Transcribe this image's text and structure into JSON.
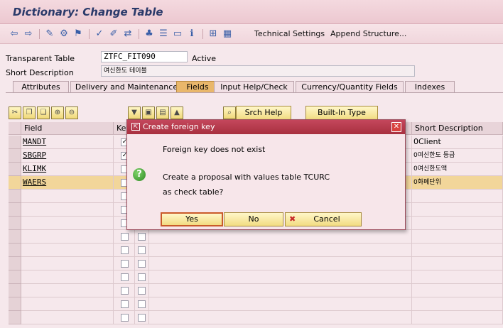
{
  "header": {
    "title": "Dictionary: Change Table"
  },
  "toolbar": {
    "icons": [
      "back-arrow-icon",
      "forward-arrow-icon",
      "display-change-icon",
      "other-object-icon",
      "activate-icon",
      "check-icon",
      "where-used-icon",
      "object-list-icon",
      "navigate-icon",
      "layout-icon",
      "info-icon",
      "hierarchy-icon",
      "table-icon"
    ],
    "technical_settings": "Technical Settings",
    "append_structure": "Append Structure..."
  },
  "form": {
    "table_type_label": "Transparent Table",
    "table_name": "ZTFC_FIT090",
    "status": "Active",
    "short_desc_label": "Short Description",
    "short_desc_value": "여신한도 테이블"
  },
  "tabs": [
    "Attributes",
    "Delivery and Maintenance",
    "Fields",
    "Input Help/Check",
    "Currency/Quantity Fields",
    "Indexes"
  ],
  "active_tab": "Fields",
  "fields_toolbar": {
    "srch_help": "Srch Help",
    "built_in_type": "Built-In Type"
  },
  "grid": {
    "headers": {
      "field": "Field",
      "key": "Key",
      "short_description": "Short Description"
    },
    "rows": [
      {
        "field": "MANDT",
        "key": true,
        "desc": "Client"
      },
      {
        "field": "SBGRP",
        "key": true,
        "desc": "여신한도 등급"
      },
      {
        "field": "KLIMK",
        "key": false,
        "desc": "여신한도액"
      },
      {
        "field": "WAERS",
        "key": false,
        "desc": "화폐단위"
      }
    ],
    "desc_prefix": "0"
  },
  "dialog": {
    "title": "Create foreign key",
    "line1": "Foreign key does not exist",
    "line2": "Create a proposal with values table TCURC",
    "line3": "as check table?",
    "yes": "Yes",
    "no": "No",
    "cancel": "Cancel"
  },
  "colors": {
    "title_bar": "#ecc8d0",
    "dialog_title": "#a8303f",
    "highlight_row": "#f2d69a",
    "button": "#f2dc82"
  }
}
